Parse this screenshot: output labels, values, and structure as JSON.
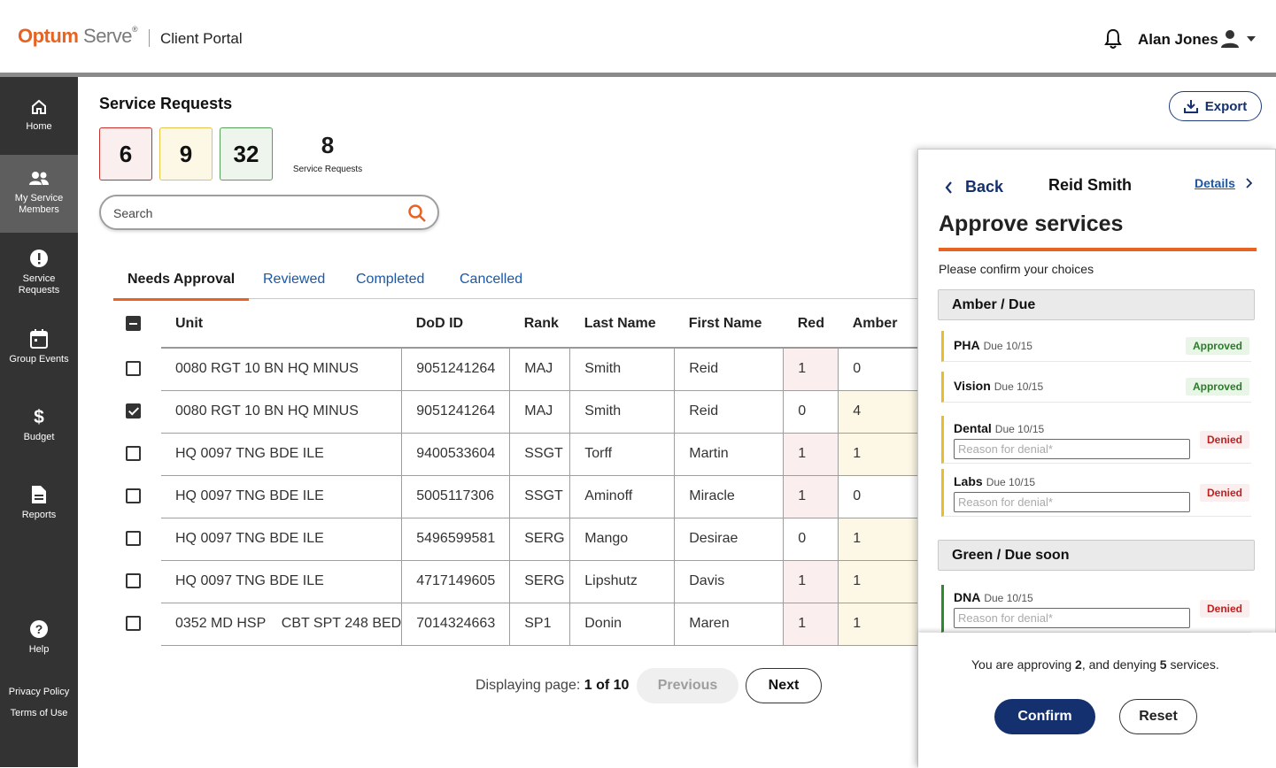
{
  "header": {
    "logo_brand": "Optum",
    "logo_product": "Serve",
    "logo_mark": "®",
    "portal": "Client Portal",
    "user_name": "Alan Jones"
  },
  "sidebar": {
    "items": [
      {
        "label": "Home",
        "icon": "home-icon"
      },
      {
        "label": "My Service Members",
        "icon": "people-icon",
        "active": true
      },
      {
        "label": "Service Requests",
        "icon": "alert-icon"
      },
      {
        "label": "Group Events",
        "icon": "calendar-icon"
      },
      {
        "label": "Budget",
        "icon": "dollar-icon"
      },
      {
        "label": "Reports",
        "icon": "document-icon"
      },
      {
        "label": "Help",
        "icon": "help-icon"
      }
    ],
    "privacy": "Privacy Policy",
    "terms": "Terms of Use"
  },
  "main": {
    "title": "Service Requests",
    "stats": {
      "red": "6",
      "amber": "9",
      "green": "32",
      "total": "8",
      "total_label": "Service Requests"
    },
    "search_placeholder": "Search",
    "export_label": "Export",
    "tabs": [
      "Needs Approval",
      "Reviewed",
      "Completed",
      "Cancelled"
    ],
    "columns": [
      "Unit",
      "DoD ID",
      "Rank",
      "Last Name",
      "First Name",
      "Red",
      "Amber"
    ],
    "rows": [
      {
        "checked": false,
        "unit": "0080 RGT 10 BN HQ MINUS",
        "dod": "9051241264",
        "rank": "MAJ",
        "last": "Smith",
        "first": "Reid",
        "red": "1",
        "amber": "0"
      },
      {
        "checked": true,
        "unit": "0080 RGT 10 BN HQ MINUS",
        "dod": "9051241264",
        "rank": "MAJ",
        "last": "Smith",
        "first": "Reid",
        "red": "0",
        "amber": "4"
      },
      {
        "checked": false,
        "unit": "HQ 0097 TNG BDE ILE",
        "dod": "9400533604",
        "rank": "SSGT",
        "last": "Torff",
        "first": "Martin",
        "red": "1",
        "amber": "1"
      },
      {
        "checked": false,
        "unit": "HQ 0097 TNG BDE ILE",
        "dod": "5005117306",
        "rank": "SSGT",
        "last": "Aminoff",
        "first": "Miracle",
        "red": "1",
        "amber": "0"
      },
      {
        "checked": false,
        "unit": "HQ 0097 TNG BDE ILE",
        "dod": "5496599581",
        "rank": "SERG",
        "last": "Mango",
        "first": "Desirae",
        "red": "0",
        "amber": "1"
      },
      {
        "checked": false,
        "unit": "HQ 0097 TNG BDE ILE",
        "dod": "4717149605",
        "rank": "SERG",
        "last": "Lipshutz",
        "first": "Davis",
        "red": "1",
        "amber": "1"
      },
      {
        "checked": false,
        "unit": "0352 MD HSP    CBT SPT 248 BED",
        "dod": "7014324663",
        "rank": "SP1",
        "last": "Donin",
        "first": "Maren",
        "red": "1",
        "amber": "1"
      }
    ],
    "pager": {
      "prefix": "Displaying page: ",
      "value": "1 of 10",
      "previous": "Previous",
      "next": "Next"
    }
  },
  "panel": {
    "back": "Back",
    "name": "Reid Smith",
    "details": "Details",
    "title": "Approve services",
    "confirm_text": "Please confirm your choices",
    "group_amber": "Amber / Due",
    "group_green": "Green / Due soon",
    "services": [
      {
        "name": "PHA",
        "due": "Due 10/15",
        "status": "Approved"
      },
      {
        "name": "Vision",
        "due": "Due 10/15",
        "status": "Approved"
      },
      {
        "name": "Dental",
        "due": "Due 10/15",
        "status": "Denied"
      },
      {
        "name": "Labs",
        "due": "Due 10/15",
        "status": "Denied"
      },
      {
        "name": "DNA",
        "due": "Due 10/15",
        "status": "Denied"
      }
    ],
    "reason_placeholder": "Reason for denial*",
    "summary_pre": "You are approving ",
    "summary_approve": "2",
    "summary_mid": ", and denying ",
    "summary_deny": "5",
    "summary_post": " services.",
    "confirm_btn": "Confirm",
    "reset_btn": "Reset"
  },
  "colors": {
    "accent": "#e86222",
    "navy": "#14306f",
    "link": "#1b57a6",
    "sidebar": "#333333"
  }
}
